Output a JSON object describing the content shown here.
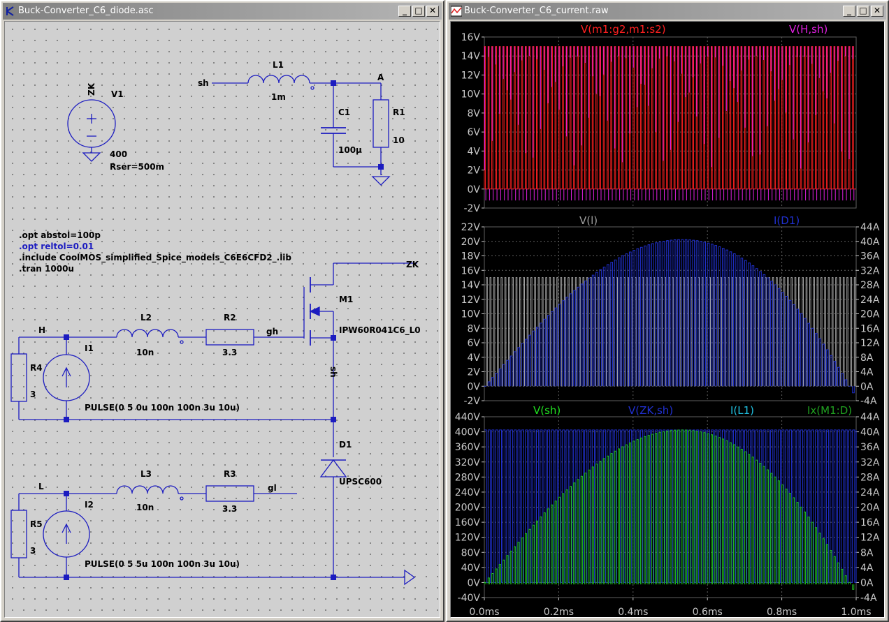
{
  "schematic_window": {
    "title": "Buck-Converter_C6_diode.asc",
    "components": {
      "v1": {
        "name": "V1",
        "polarity": "ZK",
        "value": "400",
        "rser": "Rser=500m"
      },
      "l1": {
        "name": "L1",
        "value": "1m"
      },
      "c1": {
        "name": "C1",
        "value": "100µ"
      },
      "r1": {
        "name": "R1",
        "value": "10"
      },
      "l2": {
        "name": "L2",
        "value": "10n"
      },
      "r2": {
        "name": "R2",
        "value": "3.3"
      },
      "l3": {
        "name": "L3",
        "value": "10n"
      },
      "r3": {
        "name": "R3",
        "value": "3.3"
      },
      "r4": {
        "name": "R4",
        "value": "3"
      },
      "r5": {
        "name": "R5",
        "value": "3"
      },
      "i1": {
        "name": "I1",
        "value": "PULSE(0 5 0u 100n 100n 3u 10u)"
      },
      "i2": {
        "name": "I2",
        "value": "PULSE(0 5 5u 100n 100n 3u 10u)"
      },
      "m1": {
        "name": "M1",
        "value": "IPW60R041C6_L0"
      },
      "d1": {
        "name": "D1",
        "value": "UPSC600"
      }
    },
    "net_labels": {
      "sh_top": "sh",
      "a": "A",
      "zk": "ZK",
      "gh": "gh",
      "sh_vert": "sh",
      "h": "H",
      "l": "L",
      "gl": "gl"
    },
    "directives": [
      ".opt abstol=100p",
      ".opt reltol=0.01",
      ".include CoolMOS_simplified_Spice_models_C6E6CFD2_.lib",
      ".tran 1000u"
    ]
  },
  "plot_window": {
    "title": "Buck-Converter_C6_current.raw",
    "panes": [
      {
        "traces": [
          {
            "label": "V(m1:g2,m1:s2)",
            "color": "#ff2020"
          },
          {
            "label": "V(H,sh)",
            "color": "#e020e0"
          }
        ],
        "left_ticks": [
          "16V",
          "14V",
          "12V",
          "10V",
          "8V",
          "6V",
          "4V",
          "2V",
          "0V",
          "-2V"
        ],
        "right_ticks": []
      },
      {
        "traces": [
          {
            "label": "V(l)",
            "color": "#a0a0a0"
          },
          {
            "label": "I(D1)",
            "color": "#2030d0"
          }
        ],
        "left_ticks": [
          "22V",
          "20V",
          "18V",
          "16V",
          "14V",
          "12V",
          "10V",
          "8V",
          "6V",
          "4V",
          "2V",
          "0V",
          "-2V"
        ],
        "right_ticks": [
          "44A",
          "40A",
          "36A",
          "32A",
          "28A",
          "24A",
          "20A",
          "16A",
          "12A",
          "8A",
          "4A",
          "0A",
          "-4A"
        ]
      },
      {
        "traces": [
          {
            "label": "V(sh)",
            "color": "#20e020"
          },
          {
            "label": "V(ZK,sh)",
            "color": "#2030d0"
          },
          {
            "label": "I(L1)",
            "color": "#20c0e0"
          },
          {
            "label": "Ix(M1:D)",
            "color": "#20a020"
          }
        ],
        "left_ticks": [
          "440V",
          "400V",
          "360V",
          "320V",
          "280V",
          "240V",
          "200V",
          "160V",
          "120V",
          "80V",
          "40V",
          "0V",
          "-40V"
        ],
        "right_ticks": [
          "44A",
          "40A",
          "36A",
          "32A",
          "28A",
          "24A",
          "20A",
          "16A",
          "12A",
          "8A",
          "4A",
          "0A",
          "-4A"
        ]
      }
    ],
    "x_ticks": [
      "0.0ms",
      "0.2ms",
      "0.4ms",
      "0.6ms",
      "0.8ms",
      "1.0ms"
    ],
    "colors": {
      "background": "#000000",
      "grid": "#606060",
      "axis_text": "#c8c8c8"
    }
  }
}
